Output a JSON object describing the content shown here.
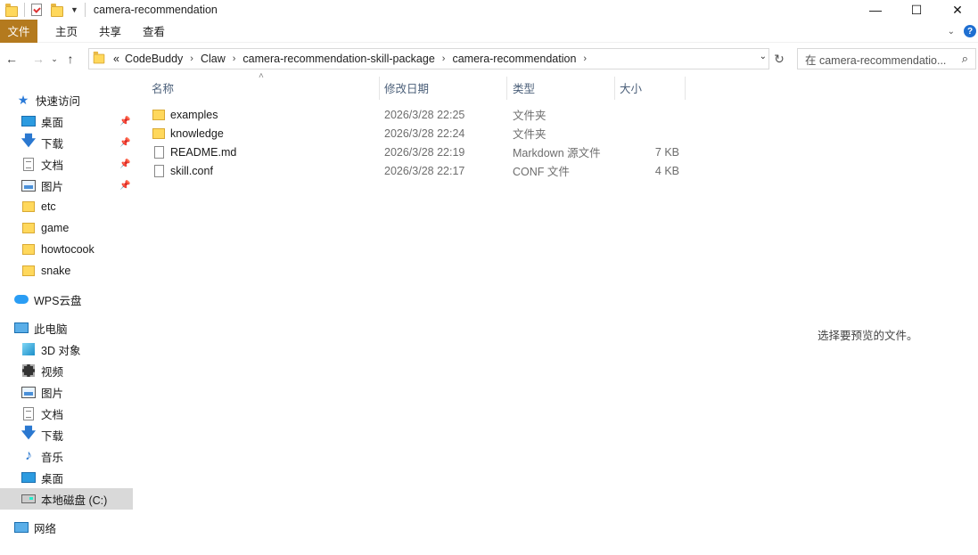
{
  "window": {
    "title": "camera-recommendation",
    "controls": {
      "minimize": "—",
      "maximize": "☐",
      "close": "✕"
    }
  },
  "ribbon": {
    "tabs": [
      "文件",
      "主页",
      "共享",
      "查看"
    ],
    "help": "?"
  },
  "nav": {
    "back": "←",
    "forward": "→",
    "recent": "⌄",
    "up": "↑",
    "address_overflow": "«",
    "breadcrumbs": [
      "CodeBuddy",
      "Claw",
      "camera-recommendation-skill-package",
      "camera-recommendation"
    ],
    "search_placeholder": "在 camera-recommendatio..."
  },
  "sidebar": {
    "quick_access": "快速访问",
    "pinned": [
      "桌面",
      "下载",
      "文档",
      "图片"
    ],
    "folders": [
      "etc",
      "game",
      "howtocook",
      "snake"
    ],
    "wps": "WPS云盘",
    "this_pc": "此电脑",
    "pc_items": [
      "3D 对象",
      "视频",
      "图片",
      "文档",
      "下载",
      "音乐",
      "桌面",
      "本地磁盘 (C:)"
    ],
    "network": "网络"
  },
  "columns": {
    "name": "名称",
    "date": "修改日期",
    "type": "类型",
    "size": "大小"
  },
  "files": [
    {
      "name": "examples",
      "date": "2026/3/28 22:25",
      "type": "文件夹",
      "size": "",
      "icon": "folder-icon"
    },
    {
      "name": "knowledge",
      "date": "2026/3/28 22:24",
      "type": "文件夹",
      "size": "",
      "icon": "folder-icon"
    },
    {
      "name": "README.md",
      "date": "2026/3/28 22:19",
      "type": "Markdown 源文件",
      "size": "7 KB",
      "icon": "markdown-file-icon"
    },
    {
      "name": "skill.conf",
      "date": "2026/3/28 22:17",
      "type": "CONF 文件",
      "size": "4 KB",
      "icon": "file-icon"
    }
  ],
  "preview_text": "选择要预览的文件。",
  "colors": {
    "file_tab": "#b47a1e",
    "selected_bg": "#d9d9d9",
    "header_text": "#4c607a"
  }
}
